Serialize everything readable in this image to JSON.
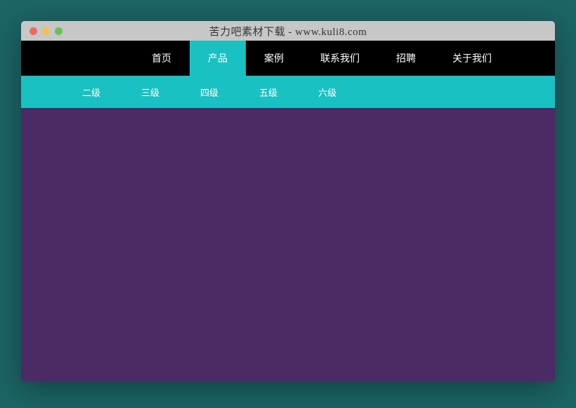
{
  "window": {
    "title": "苦力吧素材下载 - www.kuli8.com"
  },
  "nav": {
    "items": [
      {
        "label": "首页",
        "active": false
      },
      {
        "label": "产品",
        "active": true
      },
      {
        "label": "案例",
        "active": false
      },
      {
        "label": "联系我们",
        "active": false
      },
      {
        "label": "招聘",
        "active": false
      },
      {
        "label": "关于我们",
        "active": false
      }
    ]
  },
  "subnav": {
    "items": [
      {
        "label": "二级"
      },
      {
        "label": "三级"
      },
      {
        "label": "四级"
      },
      {
        "label": "五级"
      },
      {
        "label": "六级"
      }
    ]
  },
  "colors": {
    "accent": "#19c1c2",
    "content_bg": "#4b2a66",
    "page_bg": "#1c6465"
  }
}
